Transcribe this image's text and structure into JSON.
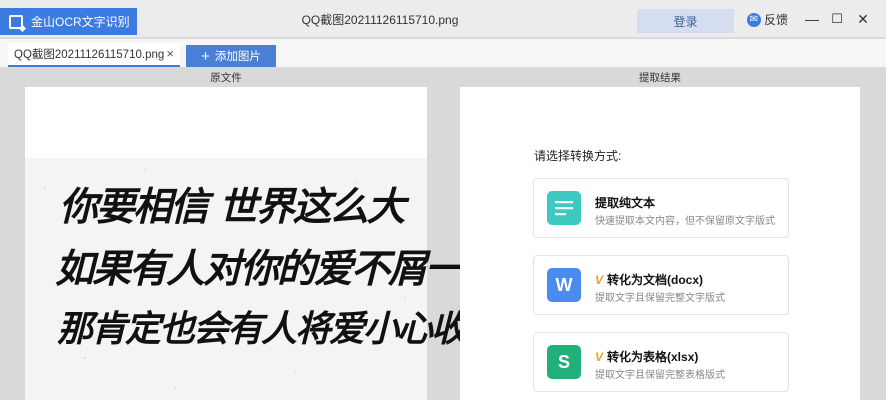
{
  "titlebar": {
    "app_name": "金山OCR文字识别",
    "window_title": "QQ截图20211126115710.png",
    "login_label": "登录",
    "feedback_label": "反馈",
    "minimize_glyph": "—",
    "maximize_glyph": "☐",
    "close_glyph": "✕"
  },
  "tabs": {
    "file_tab_label": "QQ截图20211126115710.png",
    "close_glyph": "×",
    "add_image_label": "添加图片",
    "add_glyph": "+"
  },
  "panels": {
    "left_header": "原文件",
    "right_header": "提取结果"
  },
  "source_image": {
    "handwriting_lines": [
      "你要相信 世界这么大",
      "如果有人对你的爱不屑一顾",
      "那肯定也会有人将爱小心收藏"
    ]
  },
  "result": {
    "prompt": "请选择转换方式:",
    "options": [
      {
        "title": "提取纯文本",
        "desc": "快速提取本文内容，但不保留原文字版式",
        "icon": "text-lines-icon",
        "color": "#3ec9c0",
        "vip": false
      },
      {
        "title": "转化为文档(docx)",
        "desc": "提取文字且保留完整文字版式",
        "icon": "word-doc-icon",
        "glyph": "W",
        "color": "#4a8bf0",
        "vip": true,
        "vip_glyph": "V"
      },
      {
        "title": "转化为表格(xlsx)",
        "desc": "提取文字且保留完整表格版式",
        "icon": "sheet-doc-icon",
        "glyph": "S",
        "color": "#21b07a",
        "vip": true,
        "vip_glyph": "V"
      }
    ]
  }
}
